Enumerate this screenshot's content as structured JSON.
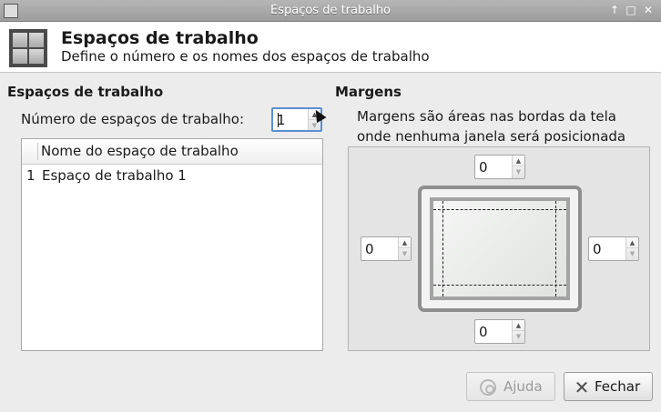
{
  "window": {
    "title": "Espaços de trabalho",
    "controls": {
      "minimize": "↑",
      "maximize": "□",
      "close": "✕"
    }
  },
  "header": {
    "title": "Espaços de trabalho",
    "subtitle": "Define o número e os nomes dos espaços de trabalho",
    "icon": "workspaces-icon"
  },
  "workspaces": {
    "section_title": "Espaços de trabalho",
    "count_label": "Número de espaços de trabalho:",
    "count_value": "1",
    "list": {
      "column_header": "Nome do espaço de trabalho",
      "rows": [
        {
          "index": "1",
          "name": "Espaço de trabalho 1"
        }
      ]
    }
  },
  "margins": {
    "section_title": "Margens",
    "description_line1": "Margens são áreas nas bordas da tela",
    "description_line2": "onde nenhuma janela será posicionada",
    "top": "0",
    "left": "0",
    "right": "0",
    "bottom": "0"
  },
  "buttons": {
    "help_label": "Ajuda",
    "close_label": "Fechar"
  },
  "icons": {
    "spin_up": "▲",
    "spin_down": "▼",
    "close_x": "✕"
  },
  "colors": {
    "titlebar": "#a8a8a8",
    "focus": "#5b8fd0",
    "background": "#ececec"
  }
}
